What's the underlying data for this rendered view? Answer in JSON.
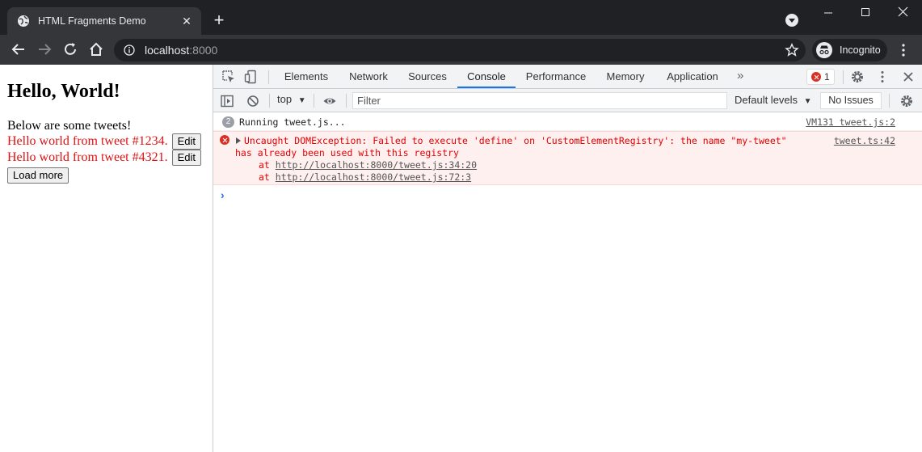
{
  "browser": {
    "tab_title": "HTML Fragments Demo",
    "url_host": "localhost",
    "url_port": ":8000",
    "profile_label": "Incognito"
  },
  "page": {
    "heading": "Hello, World!",
    "intro": "Below are some tweets!",
    "tweets": [
      {
        "text": "Hello world from tweet #1234.",
        "button": "Edit"
      },
      {
        "text": "Hello world from tweet #4321.",
        "button": "Edit"
      }
    ],
    "load_more": "Load more"
  },
  "devtools": {
    "tabs": [
      "Elements",
      "Network",
      "Sources",
      "Console",
      "Performance",
      "Memory",
      "Application"
    ],
    "active_tab": "Console",
    "more_tabs": "»",
    "error_count": "1",
    "context": "top",
    "filter_placeholder": "Filter",
    "levels": "Default levels",
    "issues": "No Issues"
  },
  "console": {
    "log": {
      "count": "2",
      "text": "Running tweet.js...",
      "source": "VM131 tweet.js:2"
    },
    "error": {
      "line1": "Uncaught DOMException: Failed to execute 'define' on 'CustomElementRegistry': the name \"my-tweet\"",
      "line2": "has already been used with this registry",
      "stack": [
        {
          "prefix": "at ",
          "link": "http://localhost:8000/tweet.js:34:20"
        },
        {
          "prefix": "at ",
          "link": "http://localhost:8000/tweet.js:72:3"
        }
      ],
      "source": "tweet.ts:42"
    },
    "prompt": "›"
  },
  "colors": {
    "tweet_text": "#e01010",
    "error_text": "#e50000",
    "error_bg": "#fff0f0",
    "active_tab_underline": "#1a73e8"
  }
}
